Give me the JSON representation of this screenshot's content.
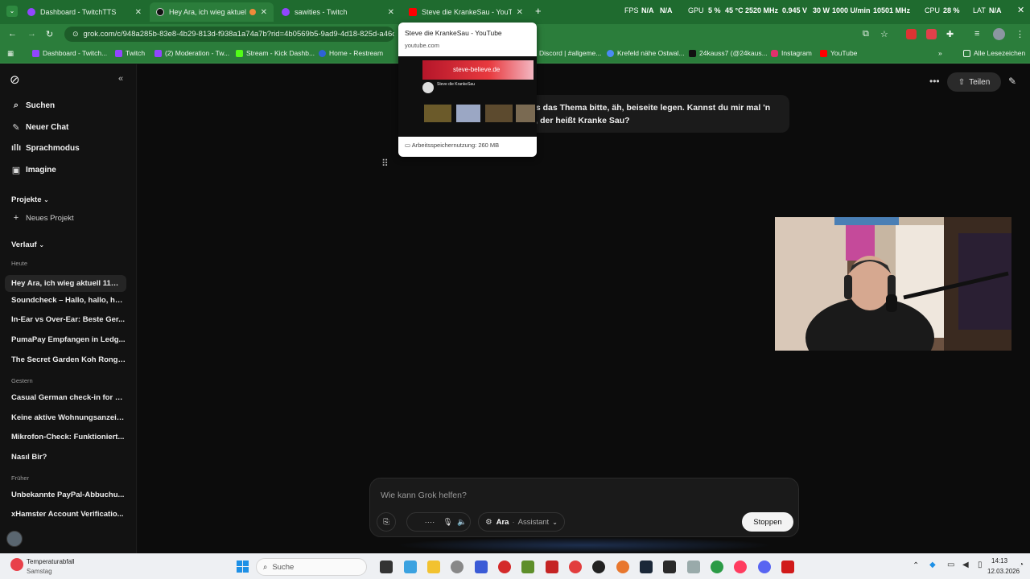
{
  "browser": {
    "tabs": [
      {
        "title": "Dashboard - TwitchTTS",
        "favicon": "twitch-icon",
        "active": false
      },
      {
        "title": "Hey Ara, ich wieg aktuell 1",
        "favicon": "grok-icon",
        "active": true
      },
      {
        "title": "sawities - Twitch",
        "favicon": "twitch-icon",
        "active": false
      },
      {
        "title": "Steve die KrankeSau - YouTube",
        "favicon": "youtube-icon",
        "active": false
      }
    ],
    "address": "grok.com/c/948a285b-83e8-4b29-813d-f938a1a74a7b?rid=4b0569b5-9ad9-4d18-825d-a46c7",
    "address_site": "grok.com",
    "bookmarks": [
      "Dashboard - Twitch...",
      "Twitch",
      "(2) Moderation - Tw...",
      "Stream - Kick Dashb...",
      "Home - Restream",
      "Discord | #allgeme...",
      "Krefeld nähe Ostwal...",
      "24kauss7 (@24kaus...",
      "Instagram",
      "YouTube"
    ],
    "all_bookmarks": "Alle Lesezeichen",
    "hud": {
      "fps_label": "FPS",
      "fps_val": "N/A",
      "fps_val2": "N/A",
      "gpu_label": "GPU",
      "gpu_load": "5 %",
      "gpu_temp": "45 °C",
      "gpu_clock": "2520 MHz",
      "gpu_volt": "0.945 V",
      "gpu_power": "30 W",
      "gpu_fan": "1000 U/min",
      "gpu_mem": "10501 MHz",
      "cpu_label": "CPU",
      "cpu_load": "28 %",
      "lat_label": "LAT",
      "lat_val": "N/A"
    },
    "hovercard": {
      "title": "Steve die KrankeSau - YouTube",
      "url": "youtube.com",
      "preview_banner": "steve-believe.de",
      "preview_channel": "Steve die KrankeSau",
      "memory": "Arbeitsspeichernutzung: 260 MB"
    }
  },
  "sidebar": {
    "nav": [
      {
        "label": "Suchen",
        "icon": "search-icon"
      },
      {
        "label": "Neuer Chat",
        "icon": "new-chat-icon"
      },
      {
        "label": "Sprachmodus",
        "icon": "waveform-icon"
      },
      {
        "label": "Imagine",
        "icon": "image-icon"
      }
    ],
    "projects_label": "Projekte",
    "new_project": "Neues Projekt",
    "history_label": "Verlauf",
    "groups": [
      {
        "label": "Heute",
        "items": [
          "Hey Ara, ich wieg aktuell 110 ...",
          "Soundcheck – Hallo, hallo, hal...",
          "In-Ear vs Over-Ear: Beste Ger...",
          "PumaPay Empfangen in Ledg...",
          "The Secret Garden Koh Rong:..."
        ]
      },
      {
        "label": "Gestern",
        "items": [
          "Casual German check-in for a...",
          "Keine aktive Wohnungsanzeig...",
          "Mikrofon-Check: Funktioniert...",
          "Nasıl Bir?"
        ]
      },
      {
        "label": "Früher",
        "items": [
          "Unbekannte PayPal-Abbuchu...",
          "xHamster Account Verificatio..."
        ]
      }
    ]
  },
  "main": {
    "share_label": "Teilen",
    "message_line1": "uns das Thema bitte, äh, beiseite legen. Kannst du mir mal 'n",
    "message_line2": "en, der heißt Kranke Sau?",
    "composer_placeholder": "Wie kann Grok helfen?",
    "voice_label": "Ara",
    "voice_mode": "Assistant",
    "stop_label": "Stoppen"
  },
  "taskbar": {
    "weather_title": "Temperaturabfall",
    "weather_sub": "Samstag",
    "search_label": "Suche",
    "time": "14:13",
    "date": "12.03.2026"
  }
}
